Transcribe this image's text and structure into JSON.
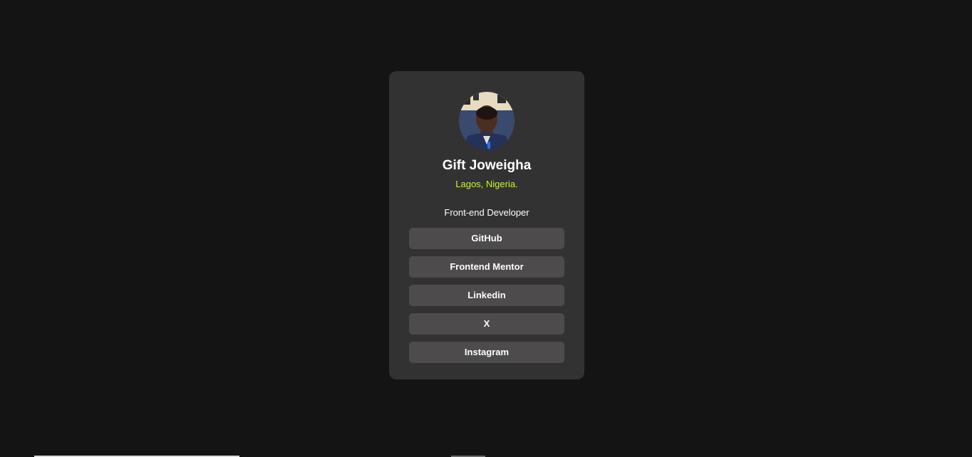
{
  "profile": {
    "name": "Gift Joweigha",
    "location": "Lagos, Nigeria.",
    "bio": "Front-end Developer",
    "avatar_icon": "profile-photo"
  },
  "links": [
    {
      "label": "GitHub"
    },
    {
      "label": "Frontend Mentor"
    },
    {
      "label": "Linkedin"
    },
    {
      "label": "X"
    },
    {
      "label": "Instagram"
    }
  ],
  "colors": {
    "background": "#141414",
    "card": "#333232",
    "button": "#4d4b4b",
    "accent": "#c4f82a",
    "text": "#ffffff"
  }
}
